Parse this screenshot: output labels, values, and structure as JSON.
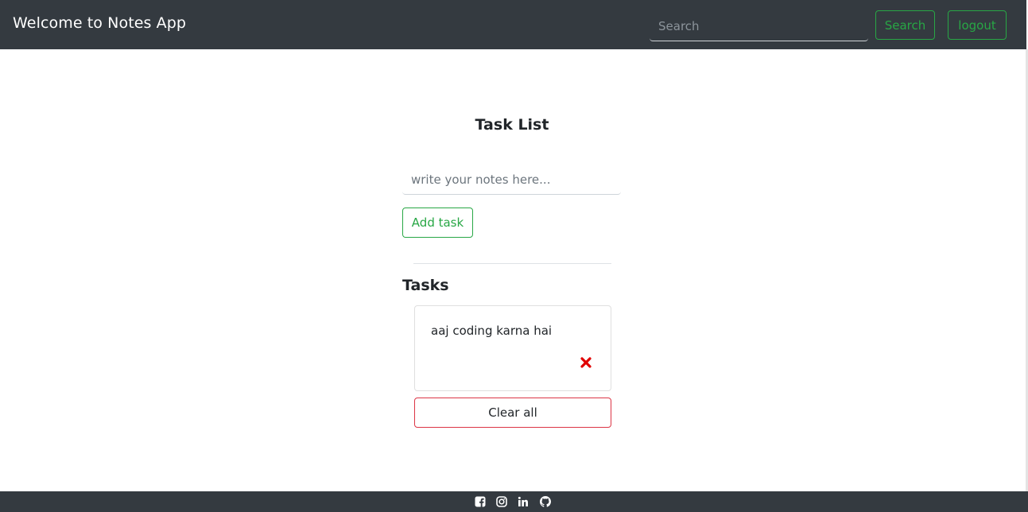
{
  "navbar": {
    "brand": "Welcome to Notes App",
    "search_placeholder": "Search",
    "search_button": "Search",
    "logout_button": "logout"
  },
  "main": {
    "title": "Task List",
    "note_placeholder": "write your notes here...",
    "add_button": "Add task",
    "tasks_heading": "Tasks",
    "tasks": [
      {
        "text": "aaj coding karna hai",
        "delete_icon": "close-icon"
      }
    ],
    "clear_button": "Clear all"
  },
  "footer": {
    "icons": [
      "facebook-icon",
      "instagram-icon",
      "linkedin-icon",
      "github-icon"
    ]
  },
  "colors": {
    "navbar_bg": "#343a40",
    "success": "#28a745",
    "danger": "#dc3545",
    "delete_red": "#e00000"
  }
}
